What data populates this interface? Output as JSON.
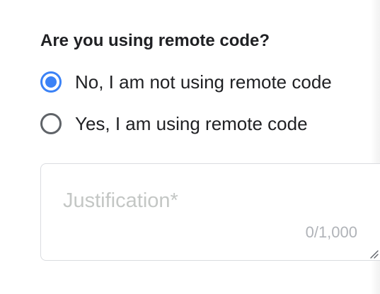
{
  "question": {
    "text": "Are you using remote code?"
  },
  "options": [
    {
      "label": "No, I am not using remote code",
      "selected": true
    },
    {
      "label": "Yes, I am using remote code",
      "selected": false
    }
  ],
  "justification": {
    "placeholder": "Justification*",
    "value": "",
    "counter": "0/1,000"
  },
  "colors": {
    "accent": "#3b82f6",
    "text": "#202124",
    "border": "#dadce0",
    "placeholder": "#c4c7c5"
  },
  "icons": {
    "resize": "resize-grip-icon"
  }
}
